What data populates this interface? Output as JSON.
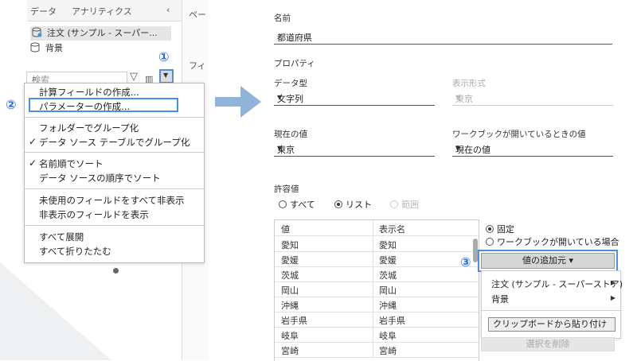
{
  "left_panel": {
    "tabs": [
      "データ",
      "アナリティクス"
    ],
    "sources": [
      "注文 (サンプル - スーパー...",
      "背景"
    ],
    "search_placeholder": "検索",
    "callout_1": "①",
    "callout_2": "②",
    "menu": {
      "items": [
        {
          "label": "計算フィールドの作成...",
          "checked": false
        },
        {
          "label": "パラメーターの作成...",
          "checked": false,
          "highlighted": true
        },
        {
          "label": "フォルダーでグループ化",
          "checked": false
        },
        {
          "label": "データ ソース テーブルでグループ化",
          "checked": true
        },
        {
          "label": "名前順でソート",
          "checked": true
        },
        {
          "label": "データ ソースの順序でソート",
          "checked": false
        },
        {
          "label": "未使用のフィールドをすべて非表示",
          "checked": false
        },
        {
          "label": "非表示のフィールドを表示",
          "checked": false
        },
        {
          "label": "すべて展開",
          "checked": false
        },
        {
          "label": "すべて折りたたむ",
          "checked": false
        }
      ]
    },
    "right_edge_labels": [
      "ペー",
      "フィ"
    ]
  },
  "dialog": {
    "name_label": "名前",
    "name_value": "都道府県",
    "properties_label": "プロパティ",
    "datatype_label": "データ型",
    "datatype_value": "文字列",
    "format_label": "表示形式",
    "format_value": "東京",
    "current_label": "現在の値",
    "current_value": "東京",
    "workbook_open_label": "ワークブックが開いているときの値",
    "workbook_open_value": "現在の値",
    "allowed_label": "許容値",
    "allowed_options": [
      "すべて",
      "リスト",
      "範囲"
    ],
    "allowed_selected": "リスト",
    "table": {
      "headers": [
        "値",
        "表示名"
      ],
      "rows": [
        [
          "愛知",
          "愛知"
        ],
        [
          "愛媛",
          "愛媛"
        ],
        [
          "茨城",
          "茨城"
        ],
        [
          "岡山",
          "岡山"
        ],
        [
          "沖縄",
          "沖縄"
        ],
        [
          "岩手県",
          "岩手県"
        ],
        [
          "岐阜",
          "岐阜"
        ],
        [
          "宮崎",
          "宮崎"
        ]
      ]
    },
    "fixed_label": "固定",
    "when_open_label": "ワークブックが開いている場合",
    "fixed_selected": true,
    "add_from_button": "値の追加元 ▾",
    "callout_3": "③",
    "submenu": {
      "items": [
        "注文 (サンプル - スーパーストア)",
        "背景"
      ],
      "clipboard_button": "クリップボードから貼り付け"
    },
    "remove_button": "選択を削除"
  },
  "colors": {
    "highlight": "#4a90e2",
    "callout": "#2a6fdb",
    "arrow": "#8fb3d9"
  }
}
